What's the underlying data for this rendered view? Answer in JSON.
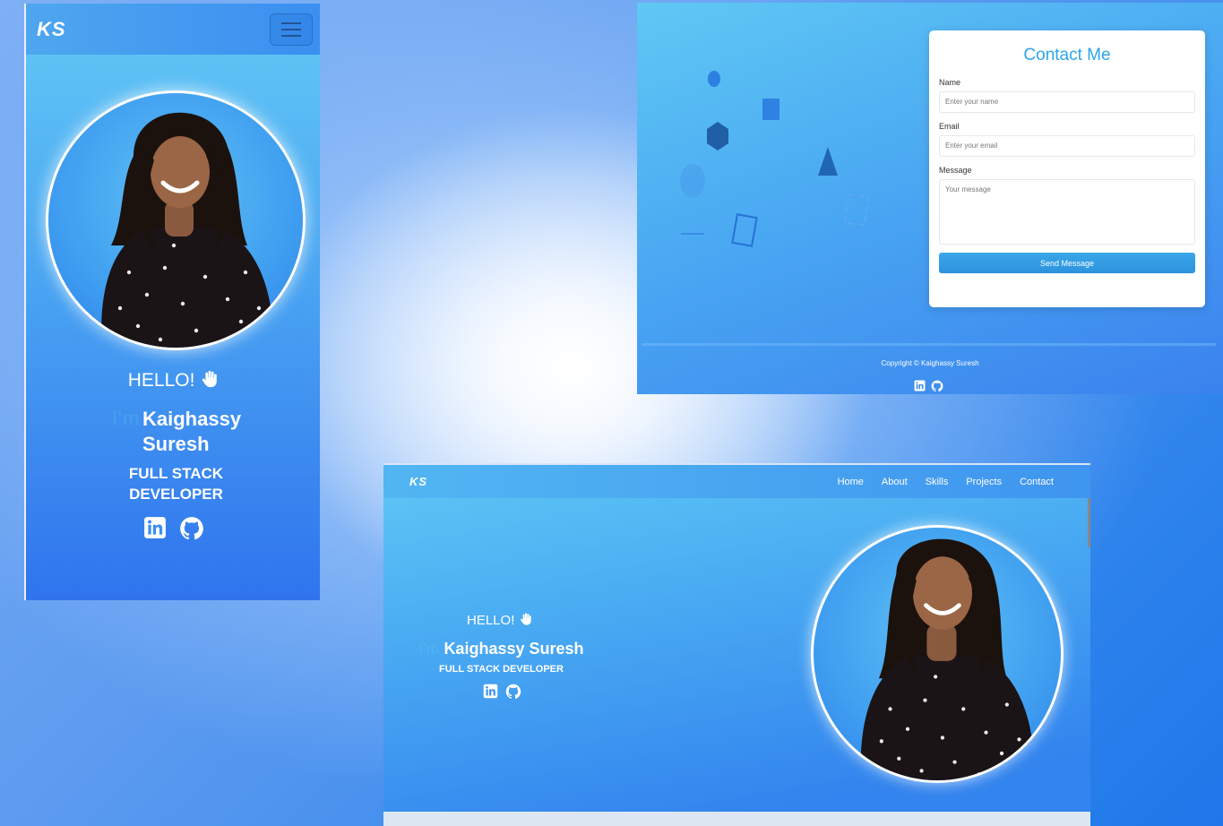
{
  "mobile": {
    "logo": "KS",
    "hello": "HELLO!",
    "im": "I'm",
    "name_line1": "Kaighassy",
    "name_line2": "Suresh",
    "role_line1": "FULL STACK",
    "role_line2": "DEVELOPER"
  },
  "contact": {
    "title": "Contact Me",
    "name_label": "Name",
    "name_placeholder": "Enter your name",
    "email_label": "Email",
    "email_placeholder": "Enter your email",
    "message_label": "Message",
    "message_placeholder": "Your message",
    "send_label": "Send Message",
    "copyright": "Copyright © Kaighassy Suresh"
  },
  "desktop": {
    "logo": "KS",
    "nav": [
      "Home",
      "About",
      "Skills",
      "Projects",
      "Contact"
    ],
    "hello": "HELLO!",
    "im": "I'm",
    "name": "Kaighassy Suresh",
    "role": "FULL STACK DEVELOPER"
  },
  "icons": [
    "menu-icon",
    "wave-hand-icon",
    "linkedin-icon",
    "github-icon"
  ],
  "colors": {
    "accent": "#2ba6e6",
    "gradient_top": "#62c9f5",
    "gradient_bottom": "#2f74ee",
    "button": "#2d92de"
  }
}
